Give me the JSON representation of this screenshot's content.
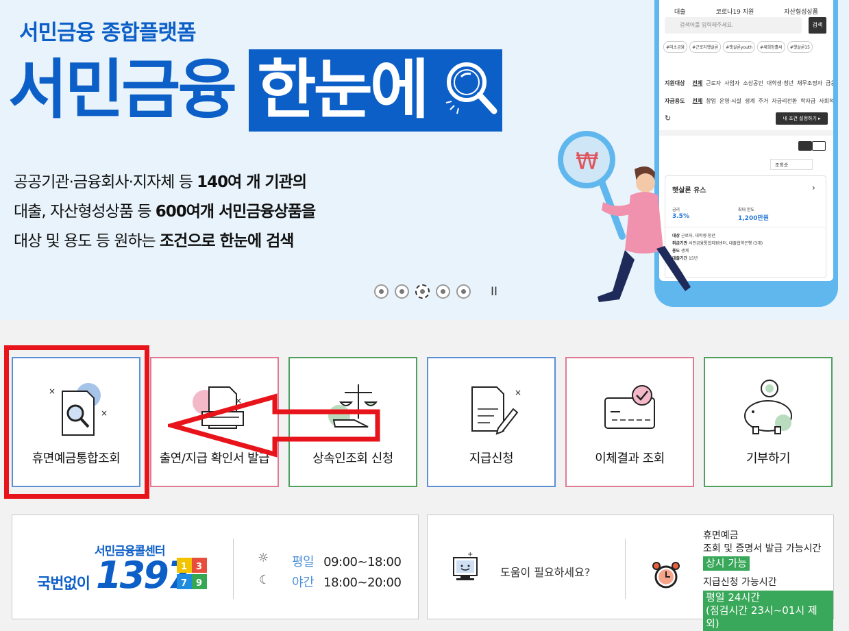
{
  "hero": {
    "subtitle": "서민금융 종합플랫폼",
    "title_part1": "서민금융",
    "title_part2": "한눈에",
    "line1_a": "공공기관·금융회사·지자체 등 ",
    "line1_b": "140여 개 기관의",
    "line2_a": "대출, 자산형성상품 등 ",
    "line2_b": "600여개 서민금융상품을",
    "line3_a": "대상 및 용도 등 원하는 ",
    "line3_b": "조건으로 한눈에 검색",
    "pause": "II"
  },
  "phone": {
    "tabs": [
      "대출",
      "코로나19 지원",
      "자산형성상품"
    ],
    "search_placeholder": "검색어를 입력해주세요.",
    "search_button": "검색",
    "tags": [
      "#미소금융",
      "#근로자햇살론",
      "#햇살론youth",
      "#새희망홀씨",
      "#햇살론15"
    ],
    "filter1_label": "지원대상",
    "filter1_items": [
      "전체",
      "근로자",
      "사업자",
      "소상공인",
      "대학생·청년",
      "채무조정자",
      "금융"
    ],
    "filter2_label": "자금용도",
    "filter2_items": [
      "전체",
      "창업",
      "운영·시설",
      "생계",
      "주거",
      "자금리전환",
      "학자금",
      "사회적"
    ],
    "set_button": "내 조건 설정하기 ▸",
    "sort": "조회순",
    "card_title": "햇살론 유스",
    "rate_label": "금리",
    "rate_value": "3.5%",
    "limit_label": "최대 한도",
    "limit_value": "1,200만원",
    "detail1_k": "대상",
    "detail1_v": "근로자, 대학생·청년",
    "detail2_k": "취급기관",
    "detail2_v": "서민금융통합지원센터, 대출협약은행 (3개)",
    "detail3_k": "용도",
    "detail3_v": "생계",
    "detail4_k": "대출기간",
    "detail4_v": "15년"
  },
  "tiles": [
    {
      "label": "휴면예금통합조회",
      "color": "#5b8fd6"
    },
    {
      "label": "출연/지급 확인서 발급",
      "color": "#e07a93"
    },
    {
      "label": "상속인조회 신청",
      "color": "#4ea060"
    },
    {
      "label": "지급신청",
      "color": "#5b8fd6"
    },
    {
      "label": "이체결과 조회",
      "color": "#e07a93"
    },
    {
      "label": "기부하기",
      "color": "#4ea060"
    }
  ],
  "callcenter": {
    "title": "서민금융콜센터",
    "prefix": "국번없이",
    "number": "1397",
    "day_label": "평일",
    "day_hours": "09:00~18:00",
    "night_label": "야간",
    "night_hours": "18:00~20:00"
  },
  "help": {
    "text": "도움이 필요하세요?",
    "avail1_line1": "휴면예금",
    "avail1_line2": "조회 및 증명서 발급 가능시간",
    "avail1_badge": "상시 가능",
    "avail2_line1": "지급신청 가능시간",
    "avail2_badge_line1": "평일 24시간",
    "avail2_badge_line2": "(점검시간 23시~01시 제외)"
  }
}
